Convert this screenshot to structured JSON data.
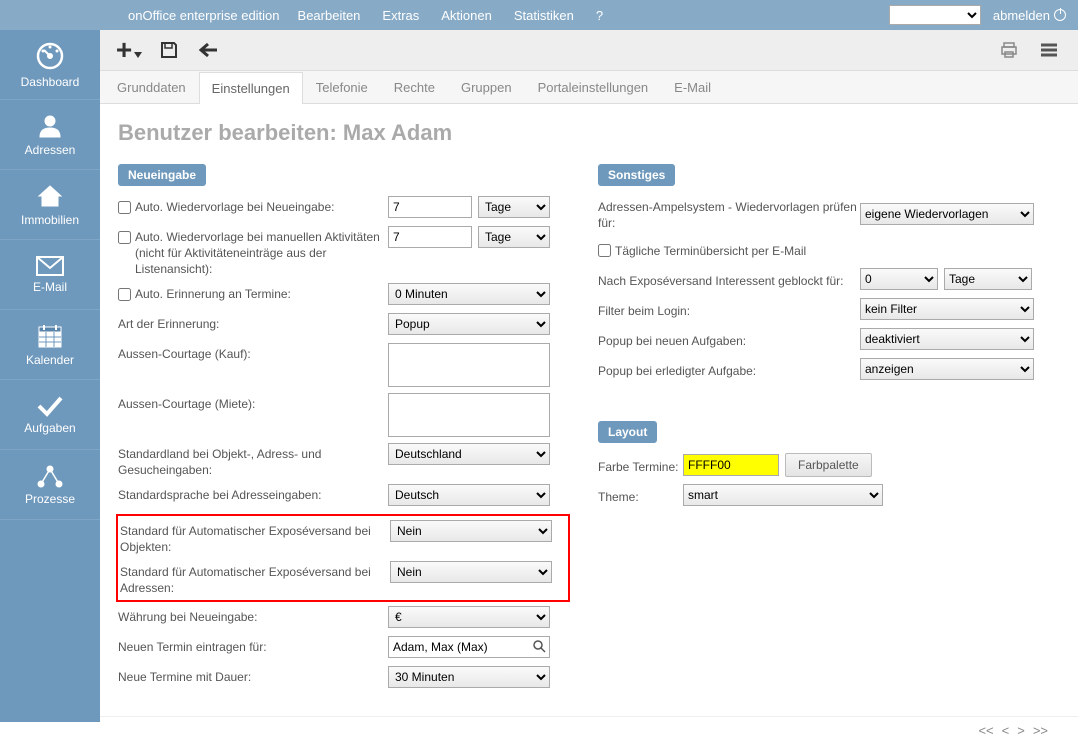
{
  "topbar": {
    "brand": "onOffice enterprise edition",
    "menu": [
      "Bearbeiten",
      "Extras",
      "Aktionen",
      "Statistiken",
      "?"
    ],
    "logout": "abmelden"
  },
  "sidebar": {
    "items": [
      {
        "label": "Dashboard"
      },
      {
        "label": "Adressen"
      },
      {
        "label": "Immobilien"
      },
      {
        "label": "E-Mail"
      },
      {
        "label": "Kalender"
      },
      {
        "label": "Aufgaben"
      },
      {
        "label": "Prozesse"
      }
    ]
  },
  "tabs": [
    "Grunddaten",
    "Einstellungen",
    "Telefonie",
    "Rechte",
    "Gruppen",
    "Portaleinstellungen",
    "E-Mail"
  ],
  "active_tab": 1,
  "page_title": "Benutzer bearbeiten: Max Adam",
  "sections": {
    "neueingabe": {
      "title": "Neueingabe",
      "auto_wiedervorlage_neu_label": "Auto. Wiedervorlage bei Neueingabe:",
      "auto_wiedervorlage_neu_value": "7",
      "auto_wiedervorlage_neu_unit": "Tage",
      "auto_wiedervorlage_man_label": "Auto. Wiedervorlage bei manuellen Aktivitäten (nicht für Aktivitäteneinträge aus der Listenansicht):",
      "auto_wiedervorlage_man_value": "7",
      "auto_wiedervorlage_man_unit": "Tage",
      "auto_erinnerung_label": "Auto. Erinnerung an Termine:",
      "auto_erinnerung_value": "0 Minuten",
      "art_erinnerung_label": "Art der Erinnerung:",
      "art_erinnerung_value": "Popup",
      "aussen_courtage_kauf_label": "Aussen-Courtage (Kauf):",
      "aussen_courtage_kauf_value": "",
      "aussen_courtage_miete_label": "Aussen-Courtage (Miete):",
      "aussen_courtage_miete_value": "",
      "standardland_label": "Standardland bei Objekt-, Adress- und Gesucheingaben:",
      "standardland_value": "Deutschland",
      "standardsprache_label": "Standardsprache bei Adresseingaben:",
      "standardsprache_value": "Deutsch",
      "expose_objekte_label": "Standard für Automatischer Exposéversand bei Objekten:",
      "expose_objekte_value": "Nein",
      "expose_adressen_label": "Standard für Automatischer Exposéversand bei Adressen:",
      "expose_adressen_value": "Nein",
      "waehrung_label": "Währung bei Neueingabe:",
      "waehrung_value": "€",
      "termin_fuer_label": "Neuen Termin eintragen für:",
      "termin_fuer_value": "Adam, Max (Max)",
      "termin_dauer_label": "Neue Termine mit Dauer:",
      "termin_dauer_value": "30 Minuten"
    },
    "sonstiges": {
      "title": "Sonstiges",
      "ampel_label": "Adressen-Ampelsystem - Wiedervorlagen prüfen für:",
      "ampel_value": "eigene Wiedervorlagen",
      "taeglich_label": "Tägliche Terminübersicht per E-Mail",
      "geblocked_label": "Nach Exposéversand Interessent geblockt für:",
      "geblocked_value": "0",
      "geblocked_unit": "Tage",
      "filter_label": "Filter beim Login:",
      "filter_value": "kein Filter",
      "popup_neu_label": "Popup bei neuen Aufgaben:",
      "popup_neu_value": "deaktiviert",
      "popup_erledigt_label": "Popup bei erledigter Aufgabe:",
      "popup_erledigt_value": "anzeigen"
    },
    "layout": {
      "title": "Layout",
      "farbe_label": "Farbe Termine:",
      "farbe_value": "FFFF00",
      "farbpalette_btn": "Farbpalette",
      "theme_label": "Theme:",
      "theme_value": "smart"
    }
  },
  "footer": {
    "first": "<<",
    "prev": "<",
    "next": ">",
    "last": ">>"
  }
}
